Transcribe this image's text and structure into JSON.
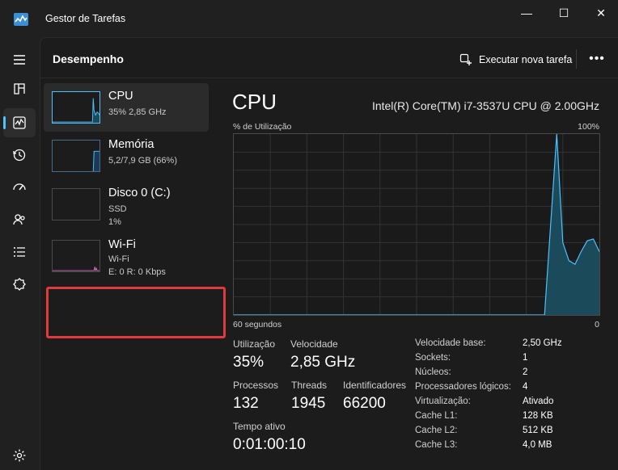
{
  "window": {
    "title": "Gestor de Tarefas",
    "minimize_glyph": "—",
    "maximize_glyph": "☐",
    "close_glyph": "✕"
  },
  "nav": {
    "items": [
      {
        "name": "menu-icon"
      },
      {
        "name": "processes-icon"
      },
      {
        "name": "performance-icon",
        "active": true
      },
      {
        "name": "app-history-icon"
      },
      {
        "name": "startup-apps-icon"
      },
      {
        "name": "users-icon"
      },
      {
        "name": "details-icon"
      },
      {
        "name": "services-icon"
      }
    ],
    "settings_icon": "gear-icon"
  },
  "header": {
    "title": "Desempenho",
    "run_task_label": "Executar nova tarefa",
    "more_label": "•••"
  },
  "devices": [
    {
      "name": "CPU",
      "line1": "35% 2,85 GHz",
      "line2": ""
    },
    {
      "name": "Memória",
      "line1": "5,2/7,9 GB (66%)",
      "line2": ""
    },
    {
      "name": "Disco 0 (C:)",
      "line1": "SSD",
      "line2": "1%"
    },
    {
      "name": "Wi-Fi",
      "line1": "Wi-Fi",
      "line2": "E: 0 R: 0 Kbps"
    }
  ],
  "detail": {
    "title": "CPU",
    "model": "Intel(R) Core(TM) i7-3537U CPU @ 2.00GHz",
    "graph_label": "% de Utilização",
    "graph_max": "100%",
    "graph_time": "60 segundos",
    "graph_min": "0",
    "stats": {
      "utilization_label": "Utilização",
      "utilization_value": "35%",
      "speed_label": "Velocidade",
      "speed_value": "2,85 GHz",
      "processes_label": "Processos",
      "processes_value": "132",
      "threads_label": "Threads",
      "threads_value": "1945",
      "handles_label": "Identificadores",
      "handles_value": "66200",
      "uptime_label": "Tempo ativo",
      "uptime_value": "0:01:00:10"
    },
    "specs": [
      {
        "key": "Velocidade base:",
        "value": "2,50 GHz"
      },
      {
        "key": "Sockets:",
        "value": "1"
      },
      {
        "key": "Núcleos:",
        "value": "2"
      },
      {
        "key": "Processadores lógicos:",
        "value": "4"
      },
      {
        "key": "Virtualização:",
        "value": "Ativado"
      },
      {
        "key": "Cache L1:",
        "value": "128 KB"
      },
      {
        "key": "Cache L2:",
        "value": "512 KB"
      },
      {
        "key": "Cache L3:",
        "value": "4,0 MB"
      }
    ]
  },
  "colors": {
    "cpu_accent": "#4cc2ff",
    "cpu_fill": "#1b4a5a",
    "memory_accent": "#4cc2ff",
    "wifi_accent": "#d26dba",
    "highlight": "#e0393e"
  },
  "chart_data": {
    "type": "area",
    "x": [
      0,
      5,
      10,
      15,
      20,
      25,
      30,
      35,
      40,
      45,
      50,
      51,
      53,
      54,
      55,
      56,
      57,
      58,
      59,
      60
    ],
    "values": [
      0,
      0,
      0,
      0,
      0,
      0,
      0,
      0,
      0,
      0,
      0,
      0,
      100,
      40,
      30,
      28,
      35,
      41,
      42,
      35
    ],
    "ylim": [
      0,
      100
    ],
    "xlim": [
      0,
      60
    ],
    "grid": true
  }
}
